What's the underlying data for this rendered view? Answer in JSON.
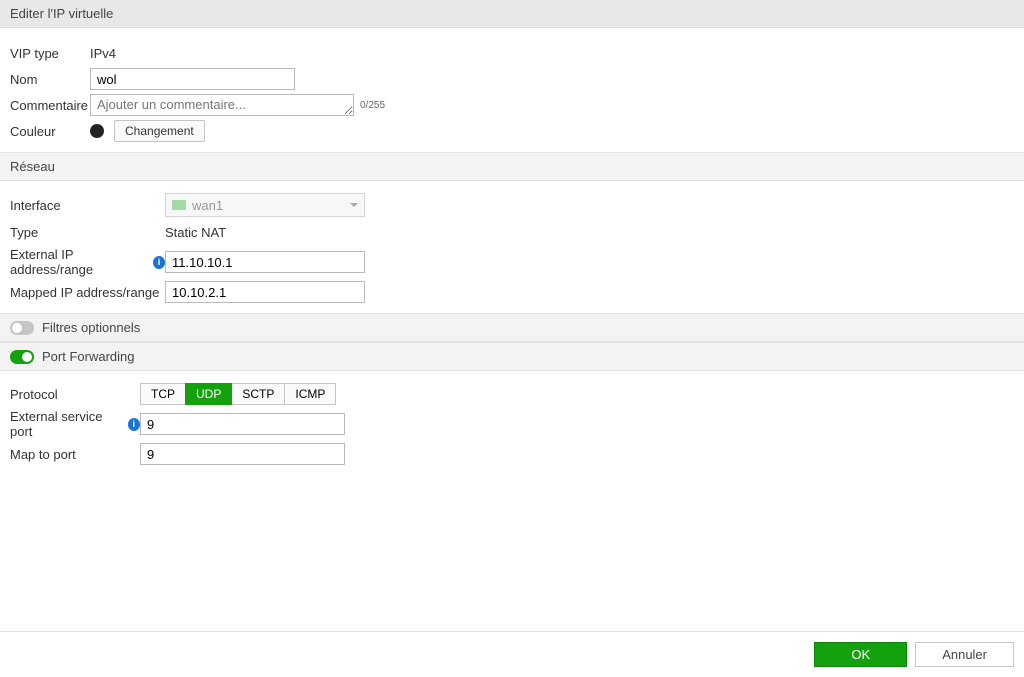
{
  "header": {
    "title": "Editer l'IP virtuelle"
  },
  "vip": {
    "type_label": "VIP type",
    "type_value": "IPv4",
    "name_label": "Nom",
    "name_value": "wol",
    "comment_label": "Commentaire",
    "comment_placeholder": "Ajouter un commentaire...",
    "comment_counter": "0/255",
    "color_label": "Couleur",
    "change_button": "Changement"
  },
  "network": {
    "section_title": "Réseau",
    "interface_label": "Interface",
    "interface_value": "wan1",
    "type_label": "Type",
    "type_value": "Static NAT",
    "external_label": "External IP address/range",
    "external_value": "11.10.10.1",
    "mapped_label": "Mapped IP address/range",
    "mapped_value": "10.10.2.1"
  },
  "filters": {
    "title": "Filtres optionnels",
    "enabled": false
  },
  "pf": {
    "title": "Port Forwarding",
    "enabled": true,
    "protocol_label": "Protocol",
    "protocols": [
      "TCP",
      "UDP",
      "SCTP",
      "ICMP"
    ],
    "protocol_selected": "UDP",
    "ext_port_label": "External service port",
    "ext_port_value": "9",
    "map_port_label": "Map to port",
    "map_port_value": "9"
  },
  "footer": {
    "ok": "OK",
    "cancel": "Annuler"
  }
}
